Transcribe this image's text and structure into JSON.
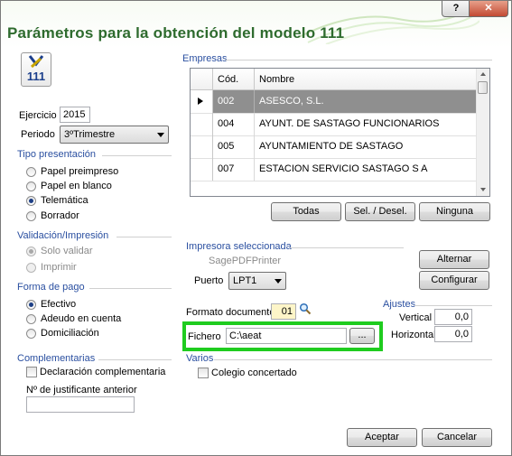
{
  "window": {
    "title": "Parámetros para la obtención del modelo 111",
    "help_button": "?",
    "close_button": "✕"
  },
  "logo": {
    "number": "111"
  },
  "ejercicio": {
    "label": "Ejercicio",
    "value": "2015"
  },
  "periodo": {
    "label": "Periodo",
    "value": "3ºTrimestre"
  },
  "tipo_presentacion": {
    "title": "Tipo presentación",
    "options": [
      "Papel preimpreso",
      "Papel en blanco",
      "Telemática",
      "Borrador"
    ],
    "selected": "Telemática"
  },
  "validacion": {
    "title": "Validación/Impresión",
    "options": [
      "Solo validar",
      "Imprimir"
    ],
    "selected": "Solo validar"
  },
  "forma_pago": {
    "title": "Forma de pago",
    "options": [
      "Efectivo",
      "Adeudo en cuenta",
      "Domiciliación"
    ],
    "selected": "Efectivo"
  },
  "complementarias": {
    "title": "Complementarias",
    "checkbox_label": "Declaración complementaria",
    "justificante_label": "Nº de justificante anterior",
    "justificante_value": ""
  },
  "empresas": {
    "title": "Empresas",
    "columns": [
      "Cód.",
      "Nombre"
    ],
    "rows": [
      {
        "cod": "002",
        "nombre": "ASESCO, S.L."
      },
      {
        "cod": "004",
        "nombre": "AYUNT. DE SASTAGO FUNCIONARIOS"
      },
      {
        "cod": "005",
        "nombre": "AYUNTAMIENTO DE SASTAGO"
      },
      {
        "cod": "007",
        "nombre": "ESTACION SERVICIO SASTAGO S A"
      }
    ],
    "buttons": {
      "todas": "Todas",
      "sel": "Sel. / Desel.",
      "ninguna": "Ninguna"
    }
  },
  "impresora": {
    "title": "Impresora seleccionada",
    "name": "SagePDFPrinter",
    "puerto_label": "Puerto",
    "puerto_value": "LPT1",
    "alternar": "Alternar",
    "configurar": "Configurar"
  },
  "formato": {
    "label": "Formato documento",
    "value": "01"
  },
  "fichero": {
    "label": "Fichero",
    "value": "C:\\aeat",
    "browse": "..."
  },
  "ajustes": {
    "title": "Ajustes",
    "vertical_label": "Vertical",
    "vertical_value": "0,0",
    "horizontal_label": "Horizontal",
    "horizontal_value": "0,0"
  },
  "varios": {
    "title": "Varios",
    "checkbox_label": "Colegio concertado"
  },
  "actions": {
    "aceptar": "Aceptar",
    "cancelar": "Cancelar"
  },
  "colors": {
    "title": "#2e6b2e",
    "section": "#2a4fa0",
    "highlight": "#1fcc1f",
    "selected_row": "#8f8f8f"
  }
}
